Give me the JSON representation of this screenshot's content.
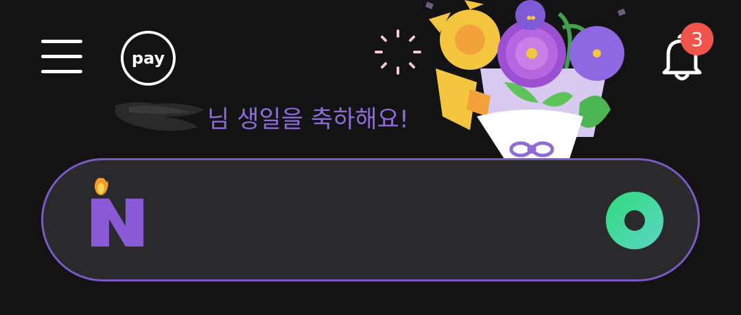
{
  "header": {
    "menu_icon": "hamburger-menu-icon",
    "pay_label": "pay",
    "notification_icon": "bell-icon",
    "notification_count": "3"
  },
  "greeting": {
    "name_redacted": true,
    "text": "님 생일을 축하해요!"
  },
  "search": {
    "logo_icon": "naver-n-candle-icon",
    "action_icon": "green-lens-icon"
  },
  "colors": {
    "background": "#131313",
    "accent_purple": "#8f6bd9",
    "search_border": "#7b5ac4",
    "search_bg": "#2a2a2c",
    "badge_red": "#f0544a",
    "lens_green": "#2fdb7a"
  }
}
